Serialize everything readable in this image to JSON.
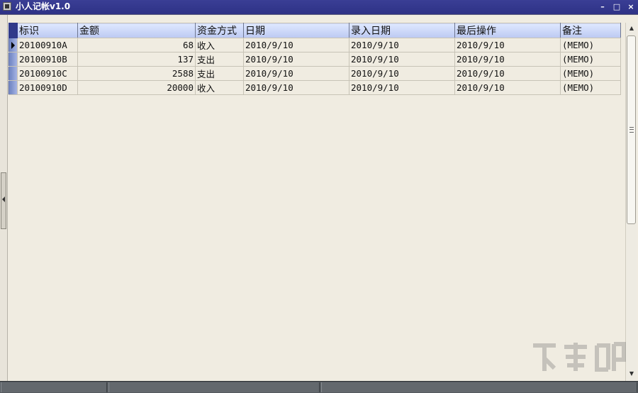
{
  "window": {
    "title": "小人记帐v1.0",
    "minimize_glyph": "–",
    "maximize_glyph": "□",
    "close_glyph": "×"
  },
  "table": {
    "columns": [
      "标识",
      "金额",
      "资金方式",
      "日期",
      "录入日期",
      "最后操作",
      "备注"
    ],
    "rows": [
      {
        "id": "20100910A",
        "amount": "68",
        "method": "收入",
        "date": "2010/9/10",
        "entry_date": "2010/9/10",
        "last_op": "2010/9/10",
        "note": "(MEMO)"
      },
      {
        "id": "20100910B",
        "amount": "137",
        "method": "支出",
        "date": "2010/9/10",
        "entry_date": "2010/9/10",
        "last_op": "2010/9/10",
        "note": "(MEMO)"
      },
      {
        "id": "20100910C",
        "amount": "2588",
        "method": "支出",
        "date": "2010/9/10",
        "entry_date": "2010/9/10",
        "last_op": "2010/9/10",
        "note": "(MEMO)"
      },
      {
        "id": "20100910D",
        "amount": "20000",
        "method": "收入",
        "date": "2010/9/10",
        "entry_date": "2010/9/10",
        "last_op": "2010/9/10",
        "note": "(MEMO)"
      }
    ],
    "current_row": 0
  },
  "colors": {
    "titlebar": "#2e3286",
    "header": "#bcc9f2",
    "background": "#f0ece1",
    "statusbar": "#555a5f"
  },
  "icons": [
    "app-icon",
    "row-pointer-icon",
    "scroll-up-icon",
    "scroll-down-icon",
    "splitter-arrow-icon"
  ]
}
